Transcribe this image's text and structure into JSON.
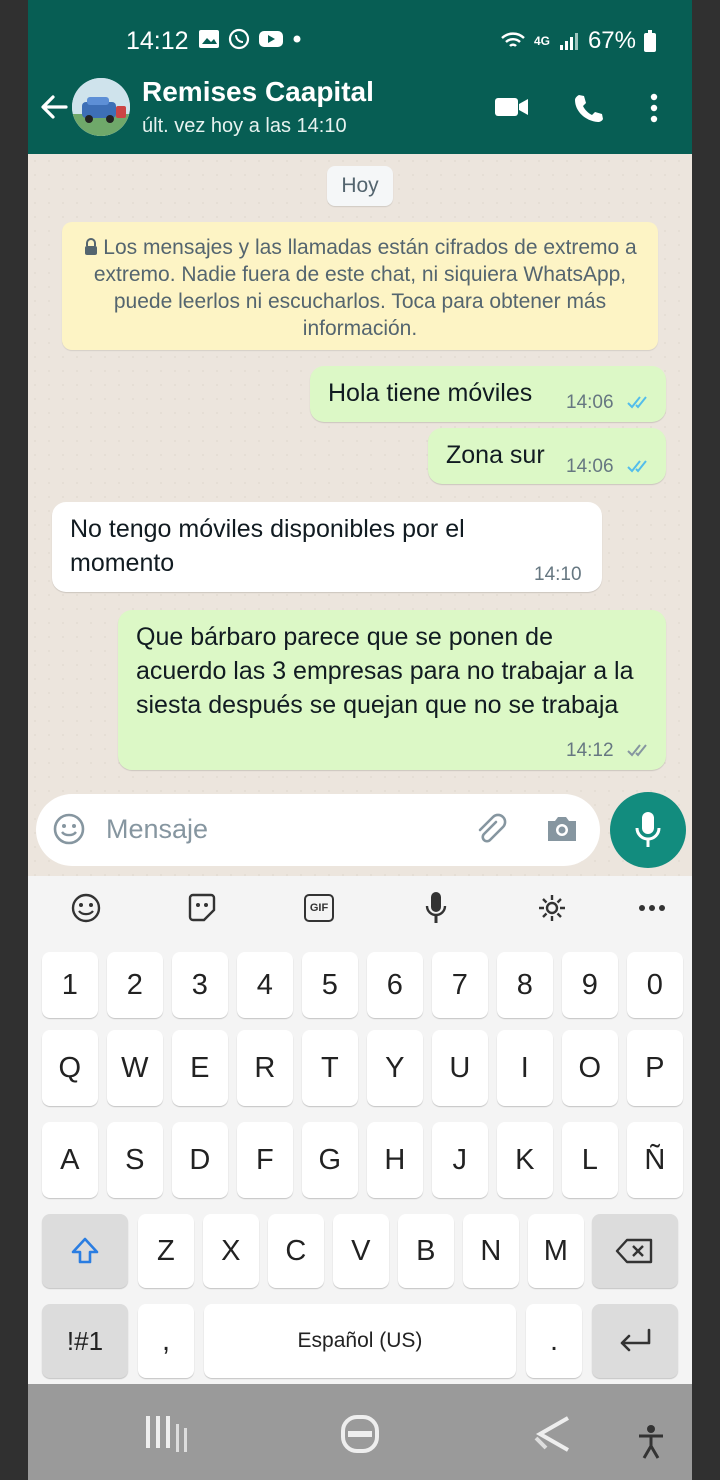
{
  "status_bar": {
    "time": "14:12",
    "battery": "67%",
    "network": "4G"
  },
  "header": {
    "contact_name": "Remises Caapital",
    "last_seen": "últ. vez hoy a las 14:10"
  },
  "chat": {
    "day_label": "Hoy",
    "encryption_notice": "Los mensajes y las llamadas están cifrados de extremo a extremo. Nadie fuera de este chat, ni siquiera WhatsApp, puede leerlos ni escucharlos. Toca para obtener más información.",
    "messages": [
      {
        "direction": "out",
        "text": "Hola tiene móviles",
        "time": "14:06",
        "status": "read"
      },
      {
        "direction": "out",
        "text": "Zona sur",
        "time": "14:06",
        "status": "read"
      },
      {
        "direction": "in",
        "text": "No tengo móviles disponibles por el momento",
        "time": "14:10"
      },
      {
        "direction": "out",
        "text": "Que bárbaro parece que se ponen de acuerdo las 3 empresas para no trabajar a la siesta después se quejan que no se trabaja",
        "time": "14:12",
        "status": "delivered"
      }
    ]
  },
  "composer": {
    "placeholder": "Mensaje"
  },
  "keyboard": {
    "row_numbers": [
      "1",
      "2",
      "3",
      "4",
      "5",
      "6",
      "7",
      "8",
      "9",
      "0"
    ],
    "row_1": [
      "Q",
      "W",
      "E",
      "R",
      "T",
      "Y",
      "U",
      "I",
      "O",
      "P"
    ],
    "row_2": [
      "A",
      "S",
      "D",
      "F",
      "G",
      "H",
      "J",
      "K",
      "L",
      "Ñ"
    ],
    "row_3": [
      "Z",
      "X",
      "C",
      "V",
      "B",
      "N",
      "M"
    ],
    "symbols_key": "!#1",
    "comma_key": ",",
    "space_label": "Español (US)",
    "period_key": ".",
    "toolbar": {
      "gif_label": "GIF"
    }
  },
  "colors": {
    "header": "#075e54",
    "outgoing": "#dcf8c6",
    "incoming": "#ffffff",
    "accent": "#128c7e",
    "read_ticks": "#53bdeb"
  }
}
